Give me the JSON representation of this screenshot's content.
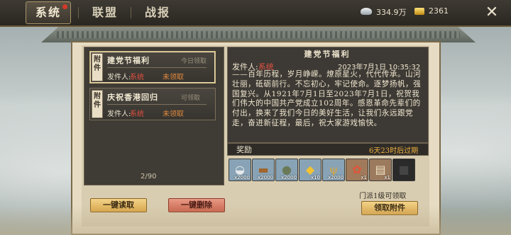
{
  "tabs": [
    {
      "label": "系统",
      "active": true,
      "has_badge": true
    },
    {
      "label": "联盟",
      "active": false
    },
    {
      "label": "战报",
      "active": false
    }
  ],
  "resources": {
    "silver": "334.9万",
    "gold": "2361"
  },
  "mail_list": [
    {
      "tag": "附件",
      "title": "建党节福利",
      "stamp": "今日领取",
      "sender_label": "发件人:",
      "sender": "系统",
      "status": "未领取",
      "selected": true
    },
    {
      "tag": "附件",
      "title": "庆祝香港回归",
      "stamp": "可领取",
      "sender_label": "发件人:",
      "sender": "系统",
      "status": "未领取",
      "selected": false
    }
  ],
  "pager": "2/90",
  "detail": {
    "title": "建党节福利",
    "sender_label": "发件人:",
    "sender": "系统",
    "date": "2023年7月1日 10:35:32",
    "body": "——百年历程，岁月峥嵘。燎原星火，代代传承。山河壮丽，砥砺前行。不忘初心，牢记使命。逐梦扬帆，强国复兴。从1921年7月1日至2023年7月1日，祝贺我们伟大的中国共产党成立102周年。感恩革命先辈们的付出，换来了我们今日的美好生活，让我们永远跟党走，奋进新征程，最后，祝大家游戏愉快。"
  },
  "reward": {
    "label": "奖励",
    "expire": "6天23时后过期",
    "items": [
      {
        "icon": "silver-ingot-icon",
        "count": "x2000"
      },
      {
        "icon": "wood-log-icon",
        "count": "x2000"
      },
      {
        "icon": "stone-sack-icon",
        "count": "x2000"
      },
      {
        "icon": "gold-ingot-icon",
        "count": "x10"
      },
      {
        "icon": "grain-icon",
        "count": "x2000"
      },
      {
        "icon": "fan-icon",
        "count": "x1"
      },
      {
        "icon": "scroll-icon",
        "count": "x1"
      },
      {
        "icon": "empty-slot-icon",
        "count": ""
      }
    ]
  },
  "hint": "门派1级可领取",
  "buttons": {
    "read_all": "一键读取",
    "delete_all": "一键删除",
    "claim": "领取附件"
  },
  "colors": {
    "accent_red": "#e05040",
    "expire_orange": "#f0b23f",
    "panel_dark": "#3d3934"
  }
}
